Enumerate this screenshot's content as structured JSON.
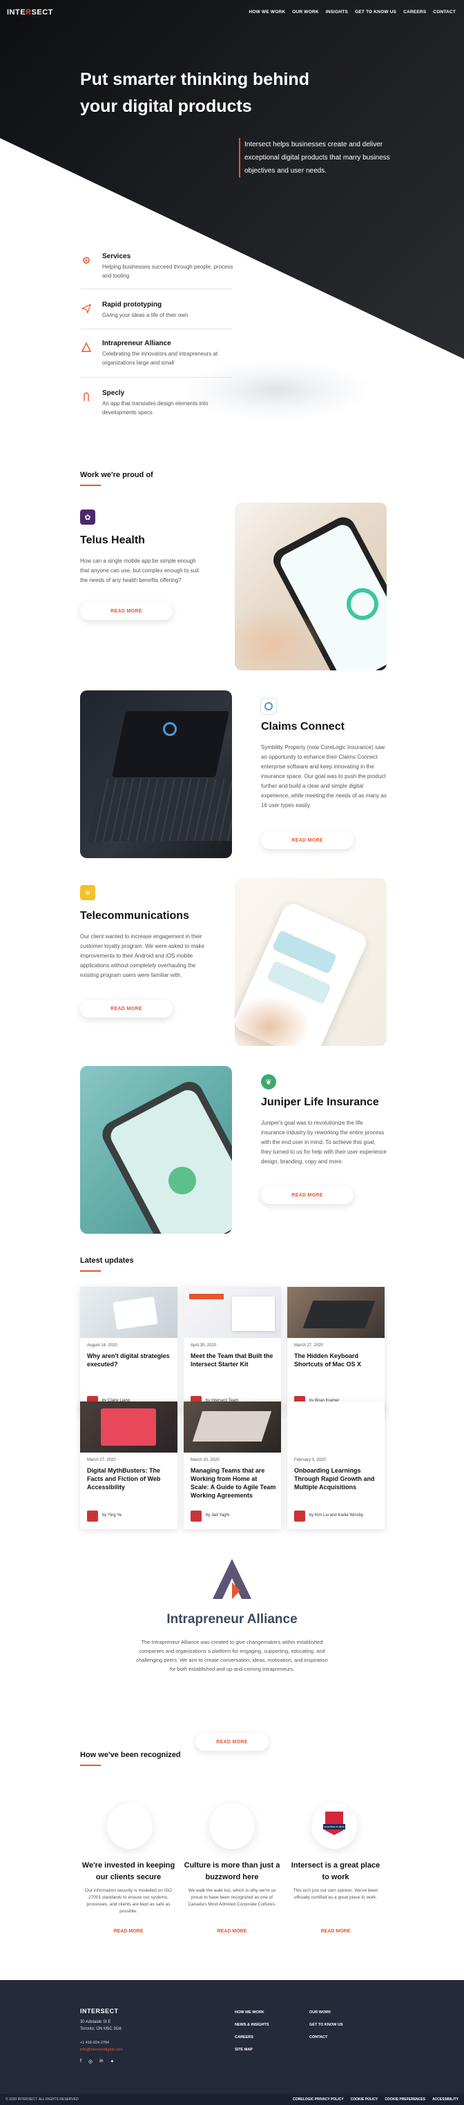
{
  "header": {
    "logo_pre": "INTE",
    "logo_mid": "R",
    "logo_post": "SECT",
    "nav": [
      "HOW WE WORK",
      "OUR WORK",
      "INSIGHTS",
      "GET TO KNOW US",
      "CAREERS",
      "CONTACT"
    ]
  },
  "hero": {
    "title_line1": "Put smarter thinking behind",
    "title_line2": "your digital products",
    "subtitle": "Intersect helps businesses create and deliver exceptional digital products that marry business objectives and user needs."
  },
  "services": [
    {
      "icon": "gear-icon",
      "title": "Services",
      "desc": "Helping businesses succeed through people, process and tooling"
    },
    {
      "icon": "paper-plane-icon",
      "title": "Rapid prototyping",
      "desc": "Giving your ideas a life of their own"
    },
    {
      "icon": "triangle-logo-icon",
      "title": "Intrapreneur Alliance",
      "desc": "Celebrating the innovators and intrapreneurs at organizations large and small"
    },
    {
      "icon": "pen-icon",
      "title": "Specly",
      "desc": "An app that translates design elements into developments specs"
    }
  ],
  "work": {
    "heading": "Work we're proud of",
    "items": [
      {
        "title": "Telus Health",
        "desc": "How can a single mobile app be simple enough that anyone can use, but complex enough to suit the needs of any health benefits offering?",
        "button": "READ MORE"
      },
      {
        "title": "Claims Connect",
        "desc": "Symbility Property (now CoreLogic Insurance) saw an opportunity to enhance their Claims Connect enterprise software and keep innovating in the insurance space. Our goal was to push the product further and build a clear and simple digital experience, while meeting the needs of as many as 16 user types easily.",
        "button": "READ MORE"
      },
      {
        "title": "Telecommunications",
        "desc": "Our client wanted to increase engagement in their customer loyalty program. We were asked to make improvements to their Android and iOS mobile applications without completely overhauling the existing program users were familiar with.",
        "button": "READ MORE"
      },
      {
        "title": "Juniper Life Insurance",
        "desc": "Juniper's goal was to revolutionize the life insurance industry by reworking the entire process with the end user in mind. To achieve this goal, they turned to us for help with their user experience design, branding, copy and more.",
        "button": "READ MORE"
      }
    ]
  },
  "updates": {
    "heading": "Latest updates",
    "items": [
      {
        "date": "August 14, 2020",
        "title": "Why aren't digital strategies executed?",
        "author": "by Claire Liang"
      },
      {
        "date": "April 30, 2020",
        "title": "Meet the Team that Built the Intersect Starter Kit",
        "author": "by Intersect Team"
      },
      {
        "date": "March 27, 2020",
        "title": "The Hidden Keyboard Shortcuts of Mac OS X",
        "author": "by Brian Kramer"
      },
      {
        "date": "March 27, 2020",
        "title": "Digital MythBusters: The Facts and Fiction of Web Accessibility",
        "author": "by Ying Ye"
      },
      {
        "date": "March 20, 2020",
        "title": "Managing Teams that are Working from Home at Scale: A Guide to Agile Team Working Agreements",
        "author": "by Jad Yaghi"
      },
      {
        "date": "February 3, 2020",
        "title": "Onboarding Learnings Through Rapid Growth and Multiple Acquisitions",
        "author": "by Kim Liu and Karlie Winsby"
      }
    ]
  },
  "alliance": {
    "title": "Intrapreneur Alliance",
    "desc": "The Intrapreneur Alliance was created to give changemakers within established companies and organizations a platform for engaging, supporting, educating, and challenging peers. We aim to create conversation, ideas, motivation, and inspiration for both established and up-and-coming intrapreneurs.",
    "button": "READ MORE"
  },
  "recognized": {
    "heading": "How we've been recognized",
    "items": [
      {
        "title": "We're invested in keeping our clients secure",
        "desc": "Our information security is modelled on ISO 27001 standards to ensure our systems, processes, and clients are kept as safe as possible.",
        "link": "READ MORE"
      },
      {
        "title": "Culture is more than just a buzzword here",
        "desc": "We walk the walk too, which is why we're so proud to have been recognized as one of Canada's Most Admired Corporate Cultures.",
        "link": "READ MORE"
      },
      {
        "title": "Intersect is a great place to work",
        "desc": "This isn't just our own opinion. We've been officially certified as a great place to work.",
        "link": "READ MORE"
      }
    ],
    "badge_text": "Great Place To Work"
  },
  "footer": {
    "logo": "INTERSECT",
    "address1": "30 Adelaide St E",
    "address2": "Toronto, ON M5C 3G8",
    "phone": "+1 416-924-2784",
    "email": "info@intersectdigital.com",
    "col1": [
      "HOW WE WORK",
      "NEWS & INSIGHTS",
      "CAREERS",
      "SITE MAP"
    ],
    "col2": [
      "OUR WORK",
      "GET TO KNOW US",
      "CONTACT"
    ],
    "copyright": "© 2020 INTERSECT. ALL RIGHTS RESERVED",
    "bottom_links": [
      "CORELOGIC PRIVACY POLICY",
      "COOKIE POLICY",
      "COOKIE PREFERENCES",
      "ACCESSIBILITY"
    ]
  },
  "colors": {
    "accent": "#e8562a",
    "dark": "#232a3a"
  }
}
